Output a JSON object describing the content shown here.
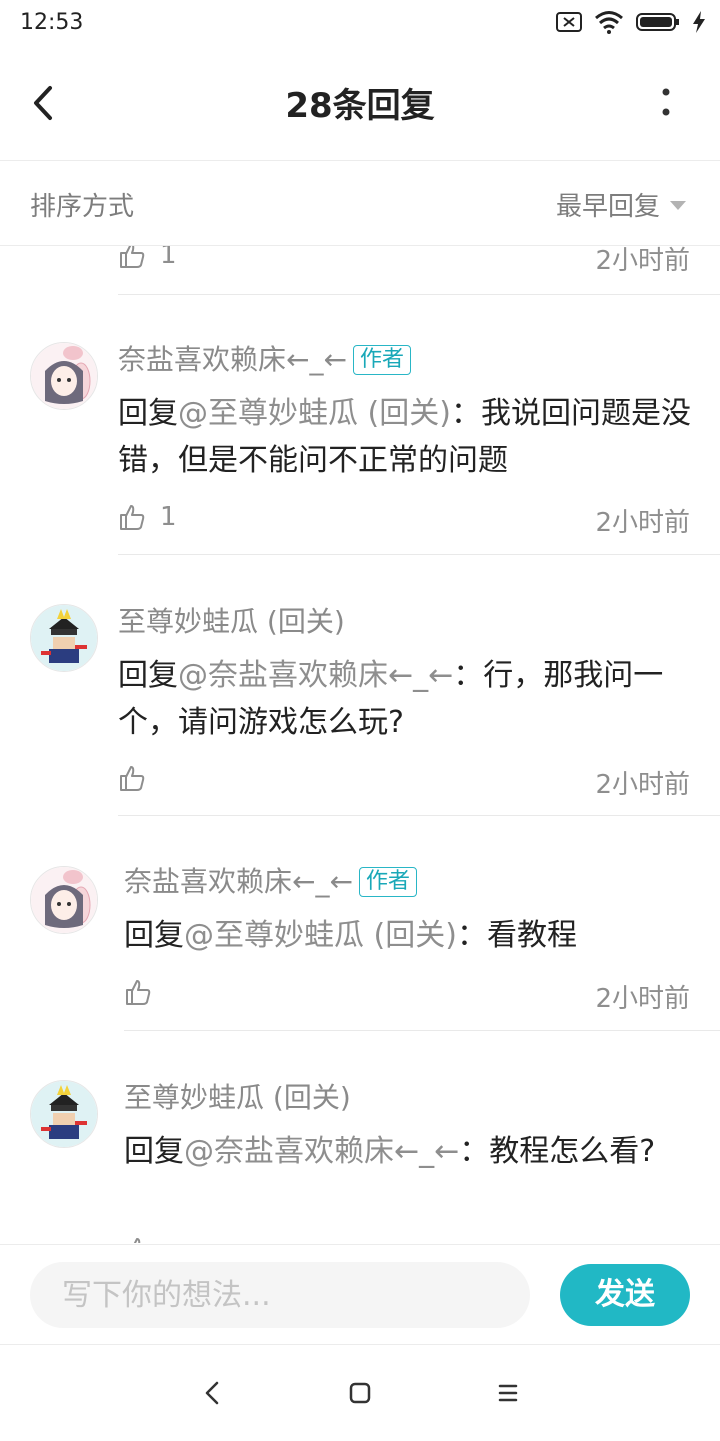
{
  "status_bar": {
    "time": "12:53"
  },
  "header": {
    "title": "28条回复"
  },
  "sort": {
    "label": "排序方式",
    "value": "最早回复"
  },
  "partial_top": {
    "likes": "1",
    "time": "2小时前"
  },
  "comments": [
    {
      "name": "奈盐喜欢赖床←_←",
      "badge": "作者",
      "reply_prefix": "回复",
      "mention": "@至尊妙蛙瓜 (回关)",
      "text": "：我说回问题是没错，但是不能问不正常的问题",
      "likes": "1",
      "time": "2小时前"
    },
    {
      "name": "至尊妙蛙瓜 (回关)",
      "reply_prefix": "回复",
      "mention": "@奈盐喜欢赖床←_←",
      "text": "：行，那我问一个，请问游戏怎么玩?",
      "likes": "",
      "time": "2小时前"
    },
    {
      "name": "奈盐喜欢赖床←_←",
      "badge": "作者",
      "reply_prefix": "回复",
      "mention": "@至尊妙蛙瓜 (回关)",
      "text": "：看教程",
      "likes": "",
      "time": "2小时前"
    },
    {
      "name": "至尊妙蛙瓜 (回关)",
      "reply_prefix": "回复",
      "mention": "@奈盐喜欢赖床←_←",
      "text": "：教程怎么看?",
      "likes": "",
      "time": ""
    }
  ],
  "composer": {
    "placeholder": "写下你的想法...",
    "send_label": "发送"
  },
  "colors": {
    "accent": "#21b8c5",
    "muted": "#8e8e8e"
  },
  "icons": [
    "back-icon",
    "more-icon",
    "like-icon",
    "nav-back-icon",
    "nav-home-icon",
    "nav-menu-icon"
  ]
}
